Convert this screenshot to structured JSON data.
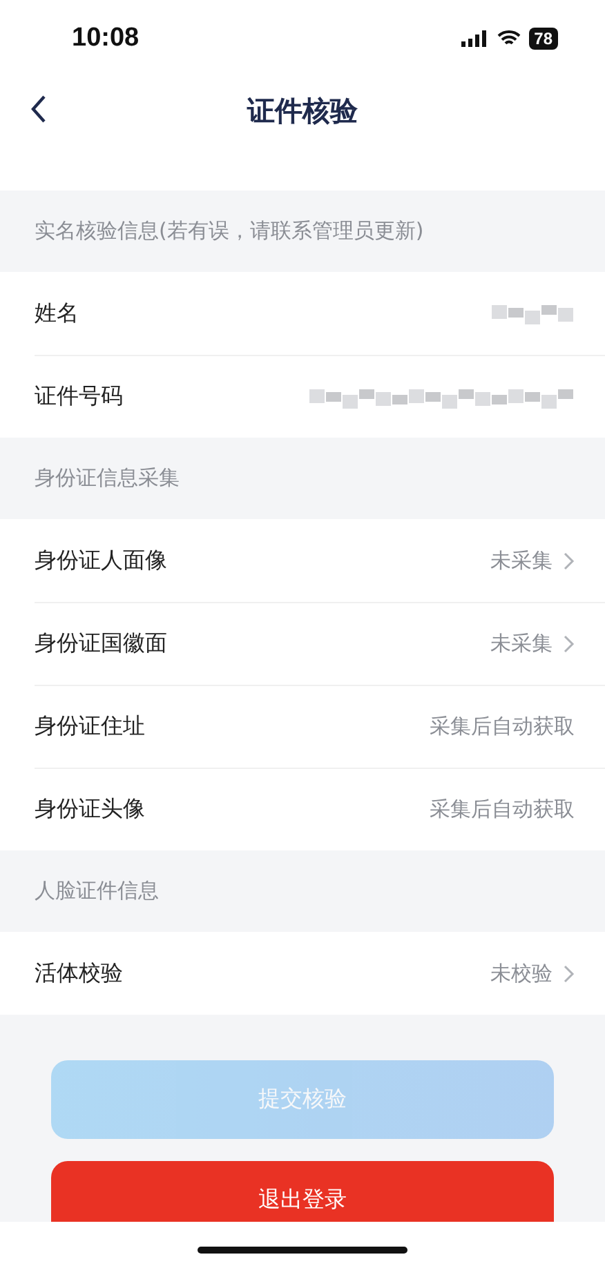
{
  "status_bar": {
    "time": "10:08",
    "battery": "78"
  },
  "header": {
    "title": "证件核验"
  },
  "sections": [
    {
      "title": "实名核验信息(若有误，请联系管理员更新)",
      "rows": [
        {
          "label": "姓名",
          "kind": "redacted",
          "chevron": false
        },
        {
          "label": "证件号码",
          "kind": "redacted",
          "chevron": false
        }
      ]
    },
    {
      "title": "身份证信息采集",
      "rows": [
        {
          "label": "身份证人面像",
          "kind": "text",
          "value": "未采集",
          "chevron": true
        },
        {
          "label": "身份证国徽面",
          "kind": "text",
          "value": "未采集",
          "chevron": true
        },
        {
          "label": "身份证住址",
          "kind": "text",
          "value": "采集后自动获取",
          "chevron": false
        },
        {
          "label": "身份证头像",
          "kind": "text",
          "value": "采集后自动获取",
          "chevron": false
        }
      ]
    },
    {
      "title": "人脸证件信息",
      "rows": [
        {
          "label": "活体校验",
          "kind": "text",
          "value": "未校验",
          "chevron": true
        }
      ]
    }
  ],
  "buttons": [
    {
      "label": "提交核验",
      "kind": "primary",
      "disabled": true
    },
    {
      "label": "退出登录",
      "kind": "danger",
      "disabled": false
    }
  ]
}
